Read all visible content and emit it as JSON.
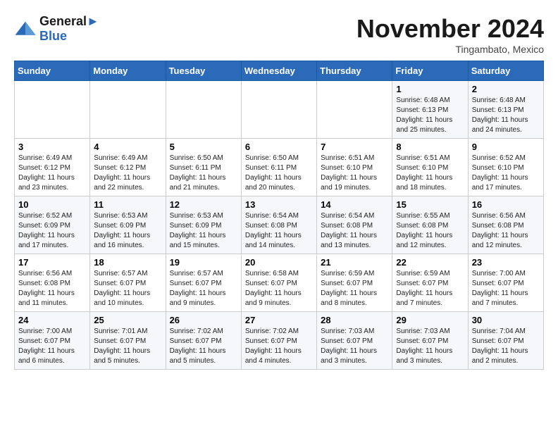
{
  "header": {
    "logo_line1": "General",
    "logo_line2": "Blue",
    "month_title": "November 2024",
    "subtitle": "Tingambato, Mexico"
  },
  "weekdays": [
    "Sunday",
    "Monday",
    "Tuesday",
    "Wednesday",
    "Thursday",
    "Friday",
    "Saturday"
  ],
  "weeks": [
    [
      {
        "day": "",
        "info": ""
      },
      {
        "day": "",
        "info": ""
      },
      {
        "day": "",
        "info": ""
      },
      {
        "day": "",
        "info": ""
      },
      {
        "day": "",
        "info": ""
      },
      {
        "day": "1",
        "info": "Sunrise: 6:48 AM\nSunset: 6:13 PM\nDaylight: 11 hours and 25 minutes."
      },
      {
        "day": "2",
        "info": "Sunrise: 6:48 AM\nSunset: 6:13 PM\nDaylight: 11 hours and 24 minutes."
      }
    ],
    [
      {
        "day": "3",
        "info": "Sunrise: 6:49 AM\nSunset: 6:12 PM\nDaylight: 11 hours and 23 minutes."
      },
      {
        "day": "4",
        "info": "Sunrise: 6:49 AM\nSunset: 6:12 PM\nDaylight: 11 hours and 22 minutes."
      },
      {
        "day": "5",
        "info": "Sunrise: 6:50 AM\nSunset: 6:11 PM\nDaylight: 11 hours and 21 minutes."
      },
      {
        "day": "6",
        "info": "Sunrise: 6:50 AM\nSunset: 6:11 PM\nDaylight: 11 hours and 20 minutes."
      },
      {
        "day": "7",
        "info": "Sunrise: 6:51 AM\nSunset: 6:10 PM\nDaylight: 11 hours and 19 minutes."
      },
      {
        "day": "8",
        "info": "Sunrise: 6:51 AM\nSunset: 6:10 PM\nDaylight: 11 hours and 18 minutes."
      },
      {
        "day": "9",
        "info": "Sunrise: 6:52 AM\nSunset: 6:10 PM\nDaylight: 11 hours and 17 minutes."
      }
    ],
    [
      {
        "day": "10",
        "info": "Sunrise: 6:52 AM\nSunset: 6:09 PM\nDaylight: 11 hours and 17 minutes."
      },
      {
        "day": "11",
        "info": "Sunrise: 6:53 AM\nSunset: 6:09 PM\nDaylight: 11 hours and 16 minutes."
      },
      {
        "day": "12",
        "info": "Sunrise: 6:53 AM\nSunset: 6:09 PM\nDaylight: 11 hours and 15 minutes."
      },
      {
        "day": "13",
        "info": "Sunrise: 6:54 AM\nSunset: 6:08 PM\nDaylight: 11 hours and 14 minutes."
      },
      {
        "day": "14",
        "info": "Sunrise: 6:54 AM\nSunset: 6:08 PM\nDaylight: 11 hours and 13 minutes."
      },
      {
        "day": "15",
        "info": "Sunrise: 6:55 AM\nSunset: 6:08 PM\nDaylight: 11 hours and 12 minutes."
      },
      {
        "day": "16",
        "info": "Sunrise: 6:56 AM\nSunset: 6:08 PM\nDaylight: 11 hours and 12 minutes."
      }
    ],
    [
      {
        "day": "17",
        "info": "Sunrise: 6:56 AM\nSunset: 6:08 PM\nDaylight: 11 hours and 11 minutes."
      },
      {
        "day": "18",
        "info": "Sunrise: 6:57 AM\nSunset: 6:07 PM\nDaylight: 11 hours and 10 minutes."
      },
      {
        "day": "19",
        "info": "Sunrise: 6:57 AM\nSunset: 6:07 PM\nDaylight: 11 hours and 9 minutes."
      },
      {
        "day": "20",
        "info": "Sunrise: 6:58 AM\nSunset: 6:07 PM\nDaylight: 11 hours and 9 minutes."
      },
      {
        "day": "21",
        "info": "Sunrise: 6:59 AM\nSunset: 6:07 PM\nDaylight: 11 hours and 8 minutes."
      },
      {
        "day": "22",
        "info": "Sunrise: 6:59 AM\nSunset: 6:07 PM\nDaylight: 11 hours and 7 minutes."
      },
      {
        "day": "23",
        "info": "Sunrise: 7:00 AM\nSunset: 6:07 PM\nDaylight: 11 hours and 7 minutes."
      }
    ],
    [
      {
        "day": "24",
        "info": "Sunrise: 7:00 AM\nSunset: 6:07 PM\nDaylight: 11 hours and 6 minutes."
      },
      {
        "day": "25",
        "info": "Sunrise: 7:01 AM\nSunset: 6:07 PM\nDaylight: 11 hours and 5 minutes."
      },
      {
        "day": "26",
        "info": "Sunrise: 7:02 AM\nSunset: 6:07 PM\nDaylight: 11 hours and 5 minutes."
      },
      {
        "day": "27",
        "info": "Sunrise: 7:02 AM\nSunset: 6:07 PM\nDaylight: 11 hours and 4 minutes."
      },
      {
        "day": "28",
        "info": "Sunrise: 7:03 AM\nSunset: 6:07 PM\nDaylight: 11 hours and 3 minutes."
      },
      {
        "day": "29",
        "info": "Sunrise: 7:03 AM\nSunset: 6:07 PM\nDaylight: 11 hours and 3 minutes."
      },
      {
        "day": "30",
        "info": "Sunrise: 7:04 AM\nSunset: 6:07 PM\nDaylight: 11 hours and 2 minutes."
      }
    ]
  ]
}
